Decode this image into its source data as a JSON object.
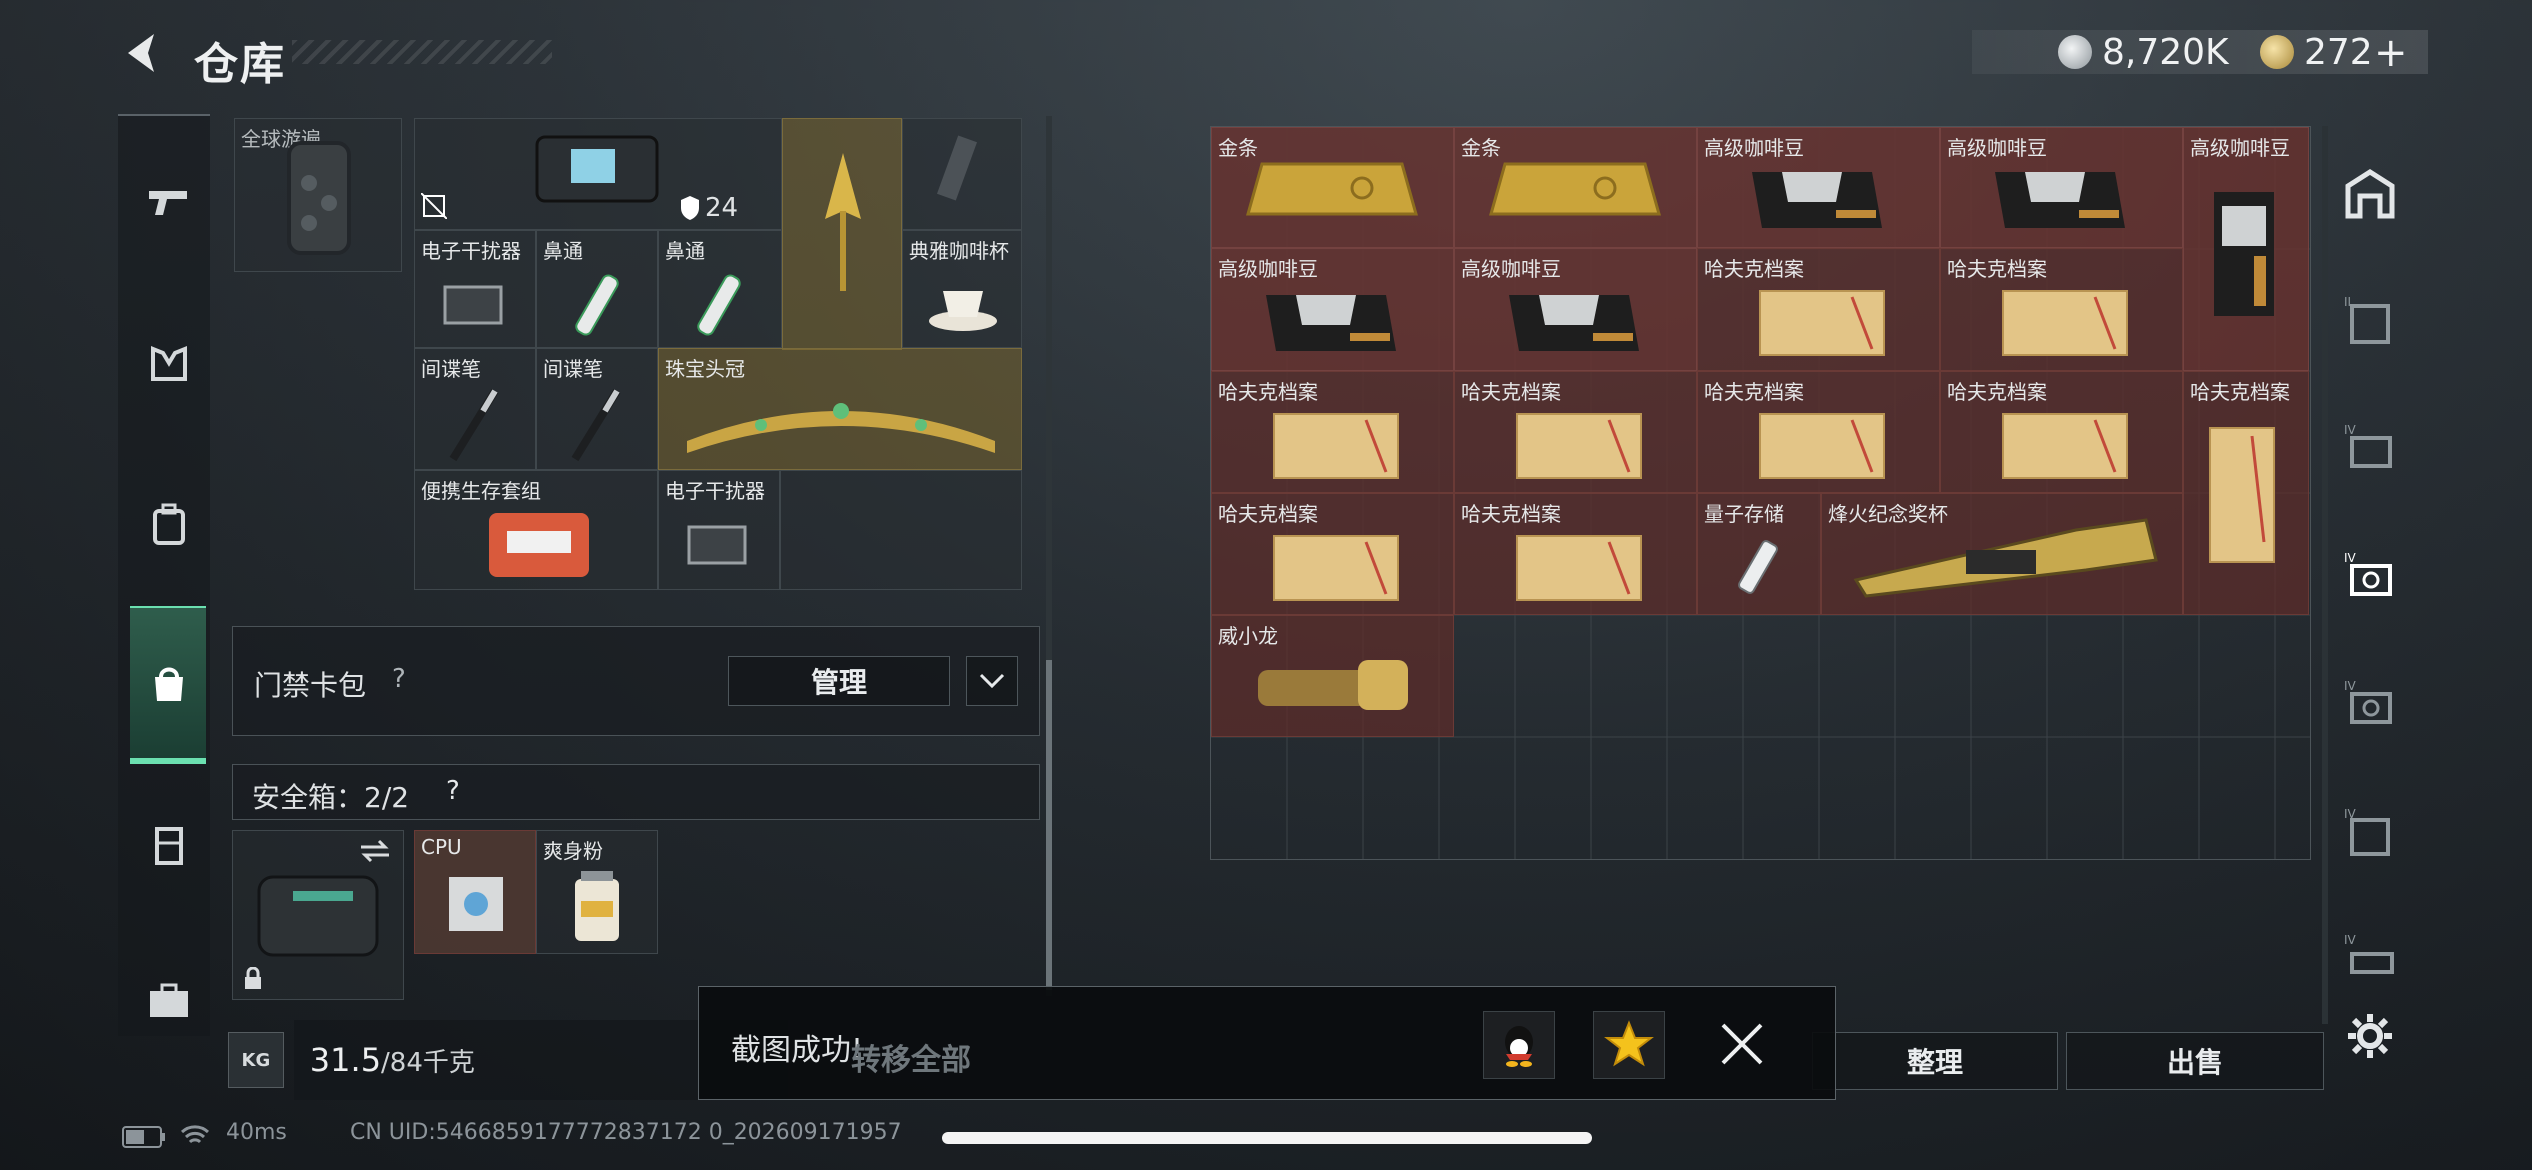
{
  "header": {
    "title": "仓库",
    "currency1": "8,720K",
    "currency2": "272",
    "plus": "+"
  },
  "left_grid": {
    "top_item_label": "全球游遍",
    "items": [
      {
        "label": "",
        "badge": ""
      },
      {
        "label": "",
        "badge": "24"
      },
      {
        "label": "电子干扰器"
      },
      {
        "label": "鼻通"
      },
      {
        "label": "鼻通"
      },
      {
        "label": "典雅咖啡杯"
      },
      {
        "label": "间谍笔"
      },
      {
        "label": "间谍笔"
      },
      {
        "label": "珠宝头冠"
      },
      {
        "label": "便携生存套组"
      },
      {
        "label": "电子干扰器"
      }
    ]
  },
  "access_card": {
    "label": "门禁卡包",
    "help": "?",
    "manage": "管理"
  },
  "safe_box": {
    "label": "安全箱：2/2",
    "help": "?",
    "items": [
      {
        "label": "CPU"
      },
      {
        "label": "爽身粉"
      }
    ]
  },
  "weight": {
    "current": "31.5",
    "max": "/84千克",
    "icon": "KG"
  },
  "right_grid": {
    "items": [
      "金条",
      "金条",
      "高级咖啡豆",
      "高级咖啡豆",
      "高级咖啡豆",
      "高级咖啡豆",
      "高级咖啡豆",
      "哈夫克档案",
      "哈夫克档案",
      "哈夫克档案",
      "哈夫克档案",
      "哈夫克档案",
      "哈夫克档案",
      "哈夫克档案",
      "哈夫克档案",
      "哈夫克档案",
      "量子存储",
      "烽火纪念奖杯",
      "威小龙"
    ]
  },
  "buttons": {
    "transfer_all": "转移全部",
    "organize": "整理",
    "sell": "出售"
  },
  "toast": {
    "text": "截图成功!"
  },
  "status_bar": {
    "ping": "40ms",
    "uid": "CN UID:5466859177772837172 0_202609171957"
  },
  "colors": {
    "accent": "#6be0b0",
    "gold_cell": "#7a6b3c",
    "red_cell": "#6a3a36"
  }
}
